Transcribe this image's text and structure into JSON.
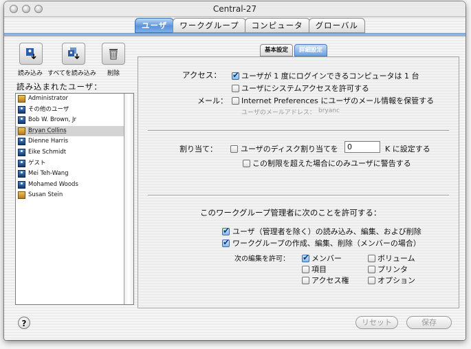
{
  "window": {
    "title": "Central-27"
  },
  "tabs": [
    "ユーザ",
    "ワークグループ",
    "コンピュータ",
    "グローバル"
  ],
  "toolbar": {
    "load": "読み込み",
    "load_all": "すべてを読み込み",
    "delete": "削除"
  },
  "users_label": "読み込まれたユーザ：",
  "users": [
    {
      "name": "Administrator",
      "icon": "admin-icon"
    },
    {
      "name": "その他のユーザ",
      "icon": "user-icon"
    },
    {
      "name": "Bob W. Brown, Jr",
      "icon": "user-icon"
    },
    {
      "name": "Bryan Collins",
      "icon": "admin-icon",
      "selected": true
    },
    {
      "name": "Dienne Harris",
      "icon": "user-icon"
    },
    {
      "name": "Eike Schmidt",
      "icon": "user-icon"
    },
    {
      "name": "ゲスト",
      "icon": "user-icon"
    },
    {
      "name": "Mei Teh-Wang",
      "icon": "user-icon"
    },
    {
      "name": "Mohamed Woods",
      "icon": "user-icon"
    },
    {
      "name": "Susan Stein",
      "icon": "admin-icon"
    }
  ],
  "subtabs": [
    "基本設定",
    "詳細設定"
  ],
  "access": {
    "label": "アクセス：",
    "opt1": "ユーザが 1 度にログインできるコンピュータは 1 台",
    "opt2": "ユーザにシステムアクセスを許可する"
  },
  "mail": {
    "label": "メール：",
    "opt": "Internet Preferences にユーザのメール情報を保管する",
    "address_label": "ユーザのメールアドレス：",
    "address_value": "bryanc"
  },
  "quota": {
    "label": "割り当て：",
    "opt": "ユーザのディスク割り当てを",
    "value": "0",
    "suffix": "K に設定する",
    "warn": "この制限を超えた場合にのみユーザに警告する"
  },
  "workgroup": {
    "heading": "このワークグループ管理者に次のことを許可する：",
    "opt1": "ユーザ（管理者を除く）の読み込み、編集、および削除",
    "opt2": "ワークグループの作成、編集、削除（メンバーの場合）",
    "edit_label": "次の編集を許可：",
    "members": "メンバー",
    "volumes": "ボリューム",
    "items": "項目",
    "printers": "プリンタ",
    "access": "アクセス権",
    "options": "オプション"
  },
  "buttons": {
    "revert": "リセット",
    "save": "保存",
    "help": "?"
  }
}
